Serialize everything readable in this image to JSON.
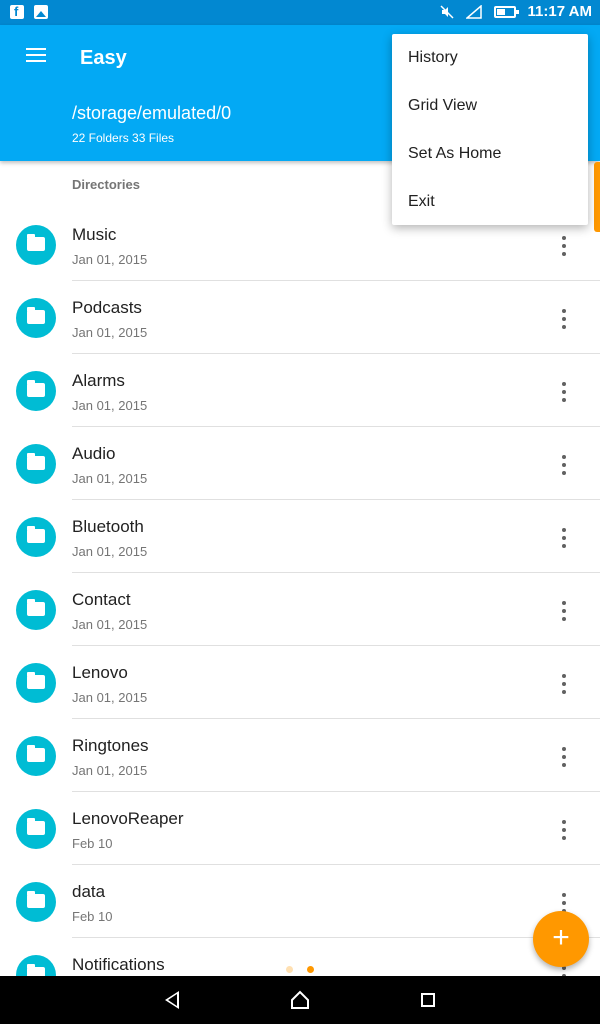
{
  "status_bar": {
    "time": "11:17 AM",
    "icons": [
      "facebook-icon",
      "image-icon",
      "mute-icon",
      "signal-icon",
      "battery-icon"
    ]
  },
  "app_bar": {
    "title": "Easy",
    "path": "/storage/emulated/0",
    "counts": "22 Folders 33 Files",
    "color": "#03a9f4"
  },
  "section": {
    "header": "Directories"
  },
  "folders": [
    {
      "name": "Music",
      "date": "Jan 01, 2015"
    },
    {
      "name": "Podcasts",
      "date": "Jan 01, 2015"
    },
    {
      "name": "Alarms",
      "date": "Jan 01, 2015"
    },
    {
      "name": "Audio",
      "date": "Jan 01, 2015"
    },
    {
      "name": "Bluetooth",
      "date": "Jan 01, 2015"
    },
    {
      "name": "Contact",
      "date": "Jan 01, 2015"
    },
    {
      "name": "Lenovo",
      "date": "Jan 01, 2015"
    },
    {
      "name": "Ringtones",
      "date": "Jan 01, 2015"
    },
    {
      "name": "LenovoReaper",
      "date": "Feb 10"
    },
    {
      "name": "data",
      "date": "Feb 10"
    },
    {
      "name": "Notifications",
      "date": ""
    }
  ],
  "overflow_menu": {
    "items": [
      "History",
      "Grid View",
      "Set As Home",
      "Exit"
    ]
  },
  "fab": {
    "label": "+",
    "color": "#ff9800"
  },
  "folder_icon_color": "#00bcd4"
}
